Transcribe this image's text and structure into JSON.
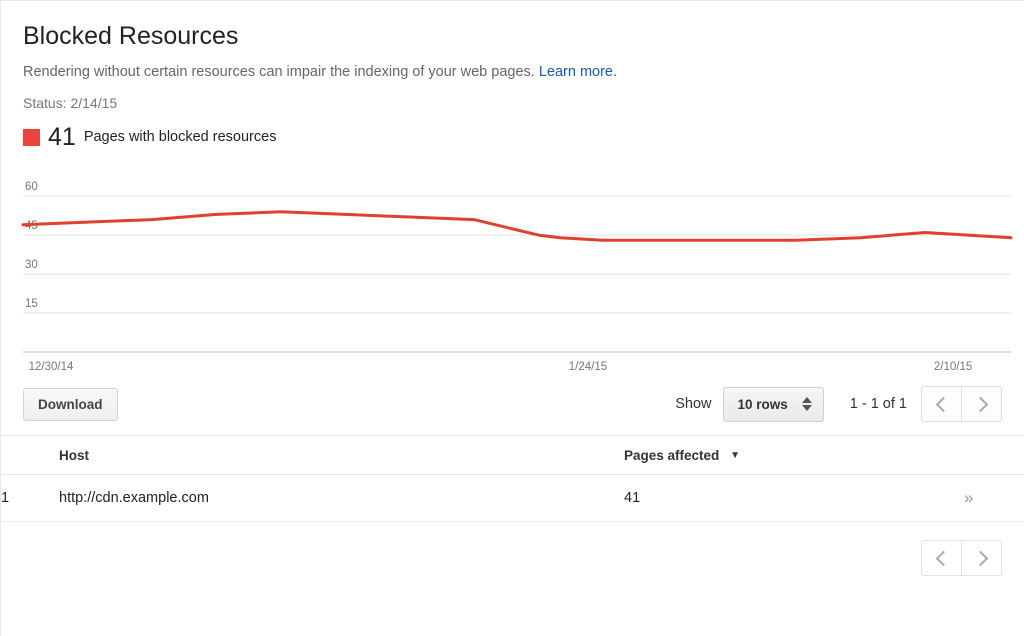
{
  "header": {
    "title": "Blocked Resources",
    "subtitle": "Rendering without certain resources can impair the indexing of your web pages.",
    "learn_more": "Learn more.",
    "status": "Status: 2/14/15",
    "legend_value": "41",
    "legend_label": "Pages with blocked resources",
    "accent_color": "#e8453c",
    "link_color": "#1a56c8"
  },
  "toolbar": {
    "download_label": "Download",
    "show_label": "Show",
    "rows_value": "10 rows",
    "range_label": "1 - 1 of 1",
    "prev_icon": "chevron-left-icon",
    "next_icon": "chevron-right-icon"
  },
  "table": {
    "columns": [
      "",
      "Host",
      "Pages affected",
      ""
    ],
    "sorted_column": "Pages affected",
    "sort_direction": "▼",
    "rows": [
      {
        "index": "1",
        "host": "http://cdn.example.com",
        "pages_affected": "41",
        "more": "»"
      }
    ]
  },
  "footer": {
    "prev_icon": "chevron-left-icon",
    "next_icon": "chevron-right-icon"
  },
  "chart_data": {
    "type": "line",
    "title": "",
    "xlabel": "",
    "ylabel": "",
    "ylim": [
      0,
      67
    ],
    "yticks": [
      15,
      30,
      45,
      60
    ],
    "grid": true,
    "legend": "Pages with blocked resources",
    "line_color": "#e0402f",
    "xticks": [
      "12/30/14",
      "1/24/15",
      "2/10/15"
    ],
    "xtick_positions": [
      0,
      25,
      42
    ],
    "x": [
      0,
      3,
      6,
      9,
      12,
      15,
      18,
      21,
      24,
      25,
      27,
      30,
      33,
      36,
      39,
      42,
      44,
      46
    ],
    "values": [
      49,
      50,
      51,
      53,
      54,
      53,
      52,
      51,
      45,
      44,
      43,
      43,
      43,
      43,
      44,
      46,
      45,
      44
    ],
    "series": [
      {
        "name": "Pages with blocked resources",
        "values": [
          49,
          50,
          51,
          53,
          54,
          53,
          52,
          51,
          45,
          44,
          43,
          43,
          43,
          43,
          44,
          46,
          45,
          44
        ]
      }
    ]
  }
}
